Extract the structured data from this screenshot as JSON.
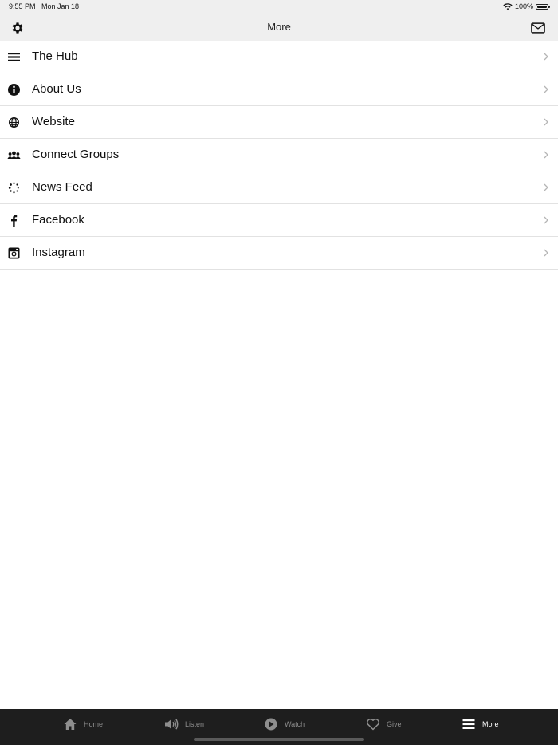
{
  "status": {
    "time": "9:55 PM",
    "date": "Mon Jan 18",
    "battery": "100%",
    "icons": [
      "wifi-icon",
      "battery-icon"
    ]
  },
  "nav": {
    "title": "More",
    "left_icon": "gear-icon",
    "right_icon": "mail-icon"
  },
  "menu": {
    "items": [
      {
        "label": "The Hub",
        "icon": "hamburger-icon"
      },
      {
        "label": "About Us",
        "icon": "info-icon"
      },
      {
        "label": "Website",
        "icon": "globe-icon"
      },
      {
        "label": "Connect Groups",
        "icon": "group-icon"
      },
      {
        "label": "News Feed",
        "icon": "spinner-icon"
      },
      {
        "label": "Facebook",
        "icon": "facebook-icon"
      },
      {
        "label": "Instagram",
        "icon": "instagram-icon"
      }
    ]
  },
  "tabs": [
    {
      "label": "Home",
      "icon": "home-icon"
    },
    {
      "label": "Listen",
      "icon": "speaker-icon"
    },
    {
      "label": "Watch",
      "icon": "play-icon"
    },
    {
      "label": "Give",
      "icon": "heart-icon"
    },
    {
      "label": "More",
      "icon": "hamburger-icon"
    }
  ],
  "active_tab": "More",
  "colors": {
    "nav_background": "#efefef",
    "tabbar_background": "#1e1e1e",
    "tab_inactive": "#8e8e8e",
    "tab_active": "#ffffff"
  }
}
